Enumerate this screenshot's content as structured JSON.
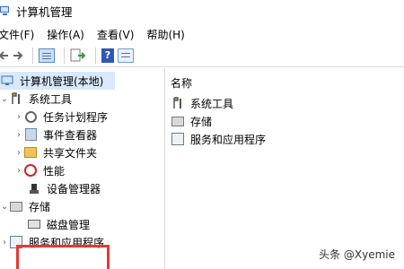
{
  "window": {
    "title": "计算机管理"
  },
  "menu": [
    {
      "label": "文件(F)"
    },
    {
      "label": "操作(A)"
    },
    {
      "label": "查看(V)"
    },
    {
      "label": "帮助(H)"
    }
  ],
  "toolbar": {
    "help_glyph": "?"
  },
  "tree": {
    "root": "计算机管理(本地)",
    "system_tools": "系统工具",
    "task_scheduler": "任务计划程序",
    "event_viewer": "事件查看器",
    "shared_folders": "共享文件夹",
    "performance": "性能",
    "device_manager": "设备管理器",
    "storage": "存储",
    "disk_management": "磁盘管理",
    "services_apps": "服务和应用程序"
  },
  "panel": {
    "column_header": "名称",
    "items": [
      {
        "label": "系统工具"
      },
      {
        "label": "存储"
      },
      {
        "label": "服务和应用程序"
      }
    ]
  },
  "watermark": "头条 @Xyemie"
}
